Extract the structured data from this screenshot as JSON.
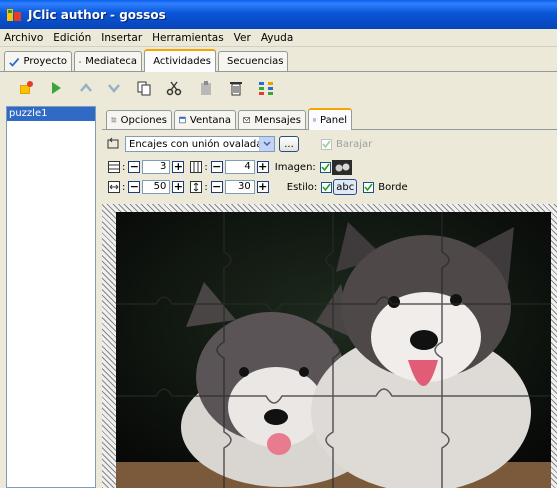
{
  "window": {
    "title": "JClic author - gossos"
  },
  "menu": [
    "Archivo",
    "Edición",
    "Insertar",
    "Herramientas",
    "Ver",
    "Ayuda"
  ],
  "main_tabs": [
    {
      "label": "Proyecto",
      "icon": "project-icon"
    },
    {
      "label": "Mediateca",
      "icon": "mediateca-icon"
    },
    {
      "label": "Actividades",
      "icon": "activities-icon",
      "selected": true
    },
    {
      "label": "Secuencias",
      "icon": "sequences-icon"
    }
  ],
  "toolbar": [
    "new-activity-icon",
    "play-icon",
    "move-up-icon",
    "move-down-icon",
    "copy-icon",
    "cut-icon",
    "paste-icon",
    "delete-icon",
    "arrange-icon"
  ],
  "activity_list": [
    "puzzle1"
  ],
  "sub_tabs": [
    {
      "label": "Opciones",
      "icon": "options-icon"
    },
    {
      "label": "Ventana",
      "icon": "window-icon"
    },
    {
      "label": "Mensajes",
      "icon": "messages-icon"
    },
    {
      "label": "Panel",
      "icon": "panel-icon",
      "selected": true
    }
  ],
  "panel": {
    "shape": "Encajes con unión ovalada",
    "more_button": "...",
    "shuffle_label": "Barajar",
    "rows_value": "3",
    "cols_value": "4",
    "image_label": "Imagen:",
    "width_value": "50",
    "height_value": "30",
    "style_label": "Estilo:",
    "style_button": "abc",
    "border_label": "Borde"
  },
  "colors": {
    "title_bar": "#0a56d8",
    "selection": "#316ac5",
    "tab_highlight": "#f6a400"
  }
}
